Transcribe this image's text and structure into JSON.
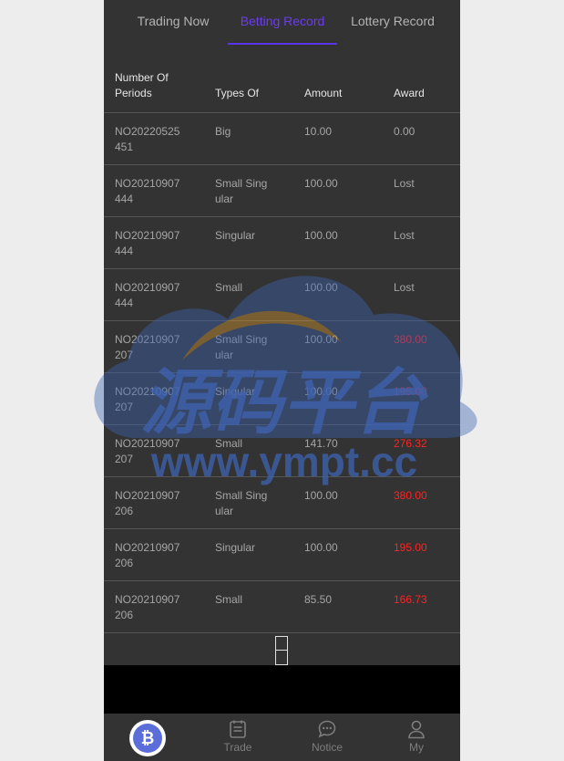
{
  "tabs": [
    {
      "label": "Trading Now",
      "active": false
    },
    {
      "label": "Betting Record",
      "active": true
    },
    {
      "label": "Lottery Record",
      "active": false
    }
  ],
  "table": {
    "headers": [
      "Number Of Periods",
      "Types Of",
      "Amount",
      "Award"
    ],
    "rows": [
      {
        "period": "NO20220525451",
        "type": "Big",
        "amount": "10.00",
        "award": "0.00",
        "won": false
      },
      {
        "period": "NO20210907444",
        "type": "Small Singular",
        "amount": "100.00",
        "award": "Lost",
        "won": false
      },
      {
        "period": "NO20210907444",
        "type": "Singular",
        "amount": "100.00",
        "award": "Lost",
        "won": false
      },
      {
        "period": "NO20210907444",
        "type": "Small",
        "amount": "100.00",
        "award": "Lost",
        "won": false
      },
      {
        "period": "NO20210907207",
        "type": "Small Singular",
        "amount": "100.00",
        "award": "380.00",
        "won": true
      },
      {
        "period": "NO20210907207",
        "type": "Singular",
        "amount": "100.00",
        "award": "195.00",
        "won": true
      },
      {
        "period": "NO20210907207",
        "type": "Small",
        "amount": "141.70",
        "award": "276.32",
        "won": true
      },
      {
        "period": "NO20210907206",
        "type": "Small Singular",
        "amount": "100.00",
        "award": "380.00",
        "won": true
      },
      {
        "period": "NO20210907206",
        "type": "Singular",
        "amount": "100.00",
        "award": "195.00",
        "won": true
      },
      {
        "period": "NO20210907206",
        "type": "Small",
        "amount": "85.50",
        "award": "166.73",
        "won": true
      }
    ]
  },
  "nav": [
    {
      "label": "",
      "icon": "bitcoin-icon"
    },
    {
      "label": "Trade",
      "icon": "document-icon"
    },
    {
      "label": "Notice",
      "icon": "chat-bubble-icon"
    },
    {
      "label": "My",
      "icon": "user-icon"
    }
  ],
  "watermark": {
    "cn_text": "源码平台",
    "url_text": "www.ympt.cc"
  },
  "colors": {
    "accent": "#6b3cf0",
    "win": "#ff2222",
    "background": "#333333"
  }
}
